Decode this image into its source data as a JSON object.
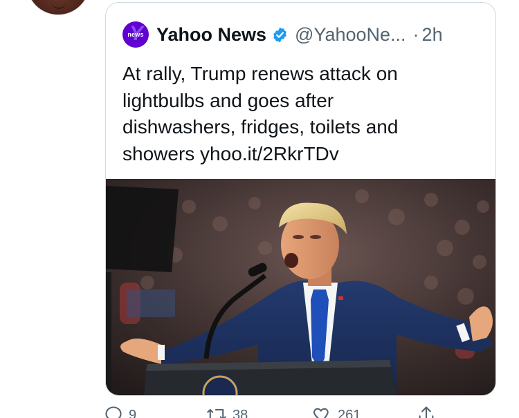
{
  "quoted_tweet": {
    "source_logo_text": "news",
    "display_name": "Yahoo News",
    "handle": "@YahooNe...",
    "separator": "·",
    "timestamp": "2h",
    "text": "At rally, Trump renews attack on lightbulbs and goes after dishwashers, fridges, toilets and showers ",
    "link": "yhoo.it/2RkrTDv"
  },
  "actions": {
    "reply_count": "9",
    "retweet_count": "38",
    "like_count": "261"
  },
  "colors": {
    "text": "#0f1419",
    "secondary": "#536471",
    "border": "#cfd9de",
    "verified": "#1d9bf0",
    "yahoo_purple": "#6001d2"
  },
  "icons": {
    "verified": "verified-badge-icon",
    "reply": "reply-icon",
    "retweet": "retweet-icon",
    "like": "heart-icon",
    "share": "share-icon"
  }
}
